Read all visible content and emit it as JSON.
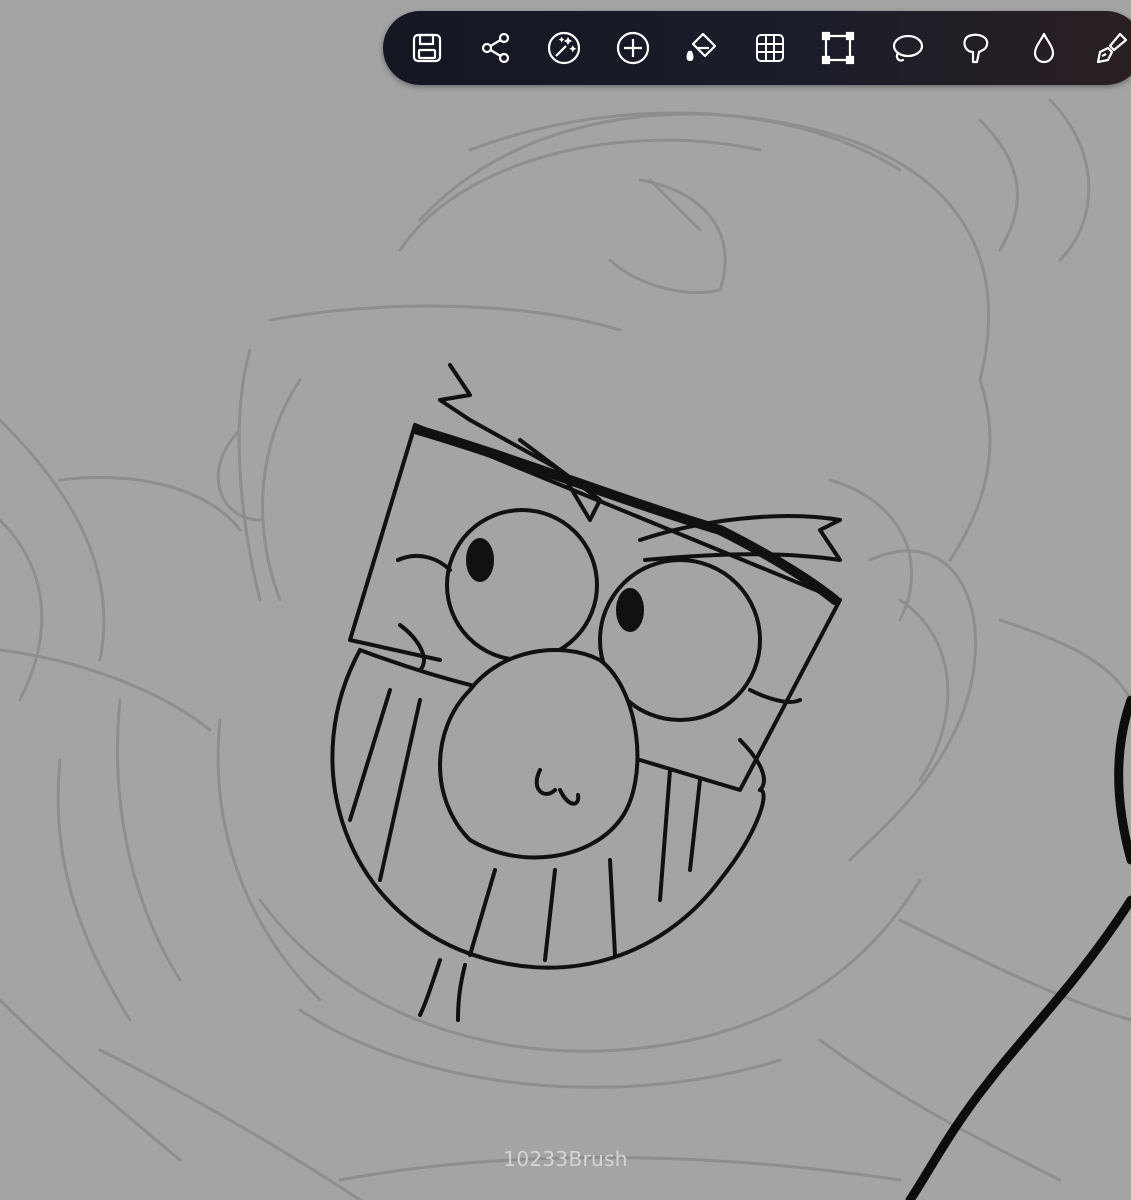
{
  "app": {
    "watermark": "10233Brush"
  },
  "toolbar": {
    "tools": [
      {
        "icon": "save-icon"
      },
      {
        "icon": "share-icon"
      },
      {
        "icon": "magic-wand-icon"
      },
      {
        "icon": "add-icon"
      },
      {
        "icon": "fill-bucket-icon"
      },
      {
        "icon": "grid-icon"
      },
      {
        "icon": "transform-icon"
      },
      {
        "icon": "lasso-icon"
      },
      {
        "icon": "smudge-icon"
      },
      {
        "icon": "blur-drop-icon"
      },
      {
        "icon": "brush-icon"
      }
    ]
  },
  "colors": {
    "canvas": "#a4a4a4",
    "toolbar_bg": "#161926",
    "icon_stroke": "#ffffff",
    "sketch_stroke": "#8a8a8a",
    "ink_stroke": "#111111"
  }
}
